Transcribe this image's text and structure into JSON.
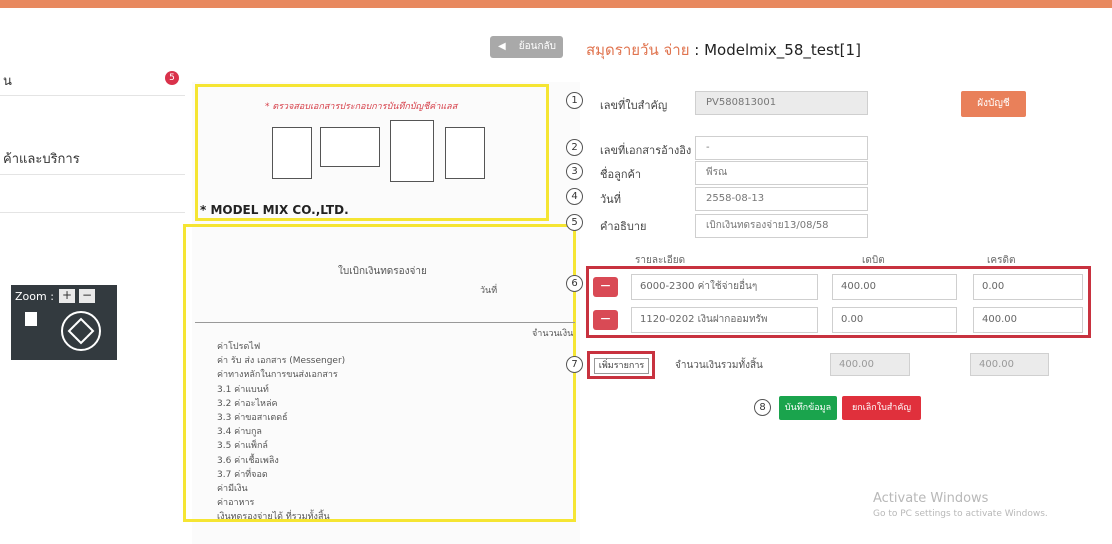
{
  "topbar_color": "#e8895f",
  "sidebar": {
    "items": [
      {
        "label": "น",
        "badge": "5"
      },
      {
        "label": "ค้าและบริการ"
      },
      {
        "label": ""
      }
    ]
  },
  "zoom": {
    "label": "Zoom :",
    "plus": "+",
    "minus": "−"
  },
  "document": {
    "note": "* ตรวจสอบเอกสารประกอบการบันทึกบัญชีค่าแลส",
    "company": "* MODEL MIX CO.,LTD.",
    "voucher_title": "ใบเบิกเงินทดรองจ่าย",
    "date_label": "วันที่",
    "rows": [
      "ค่าโปรดไฟ",
      "ค่า รับ ส่ง เอกสาร (Messenger)",
      "ค่าทางหลักในการขนส่งเอกสาร",
      "3.1 ค่าแบนท์",
      "3.2 ค่าอะไหล่ค",
      "3.3 ค่าขอสาเตดธ์",
      "3.4 ค่าบกูล",
      "3.5 ค่าแพ็กล์",
      "3.6 ค่าเชื้อเพลิง",
      "3.7 ค่าที่จอด",
      "ค่ามีเงิน",
      "ค่าอาหาร",
      "เงินทดรองจ่ายได้ ที่รวมทั้งสิ้น"
    ],
    "col_total": "จำนวนเงิน"
  },
  "header": {
    "back_label": "ย้อนกลับ",
    "title_prefix": "สมุดรายวัน จ่าย",
    "title_suffix": " : Modelmix_58_test[1]"
  },
  "form": {
    "fields": [
      {
        "num": "1",
        "label": "เลขที่ใบสำคัญ",
        "value": "PV580813001"
      },
      {
        "num": "2",
        "label": "เลขที่เอกสารอ้างอิง",
        "value": "-"
      },
      {
        "num": "3",
        "label": "ชื่อลูกค้า",
        "value": "พีรณ"
      },
      {
        "num": "4",
        "label": "วันที่",
        "value": "2558-08-13"
      },
      {
        "num": "5",
        "label": "คำอธิบาย",
        "value": "เบิกเงินทดรองจ่าย13/08/58"
      }
    ],
    "account_button": "ผังบัญชี"
  },
  "lines": {
    "num": "6",
    "headers": {
      "detail": "รายละเอียด",
      "debit": "เดบิต",
      "credit": "เครดิต"
    },
    "rows": [
      {
        "account": "6000-2300 ค่าใช้จ่ายอื่นๆ",
        "debit": "400.00",
        "credit": "0.00"
      },
      {
        "account": "1120-0202 เงินฝากออมทรัพ",
        "debit": "0.00",
        "credit": "400.00"
      }
    ],
    "remove_label": "−"
  },
  "totals": {
    "num": "7",
    "add_label": "เพิ่มรายการ",
    "label": "จำนวนเงินรวมทั้งสิ้น",
    "debit": "400.00",
    "credit": "400.00"
  },
  "actions": {
    "num": "8",
    "save_label": "บันทึกข้อมูล",
    "cancel_label": "ยกเลิกใบสำคัญ"
  },
  "watermark": {
    "line1": "Activate Windows",
    "line2": "Go to PC settings to activate Windows."
  }
}
